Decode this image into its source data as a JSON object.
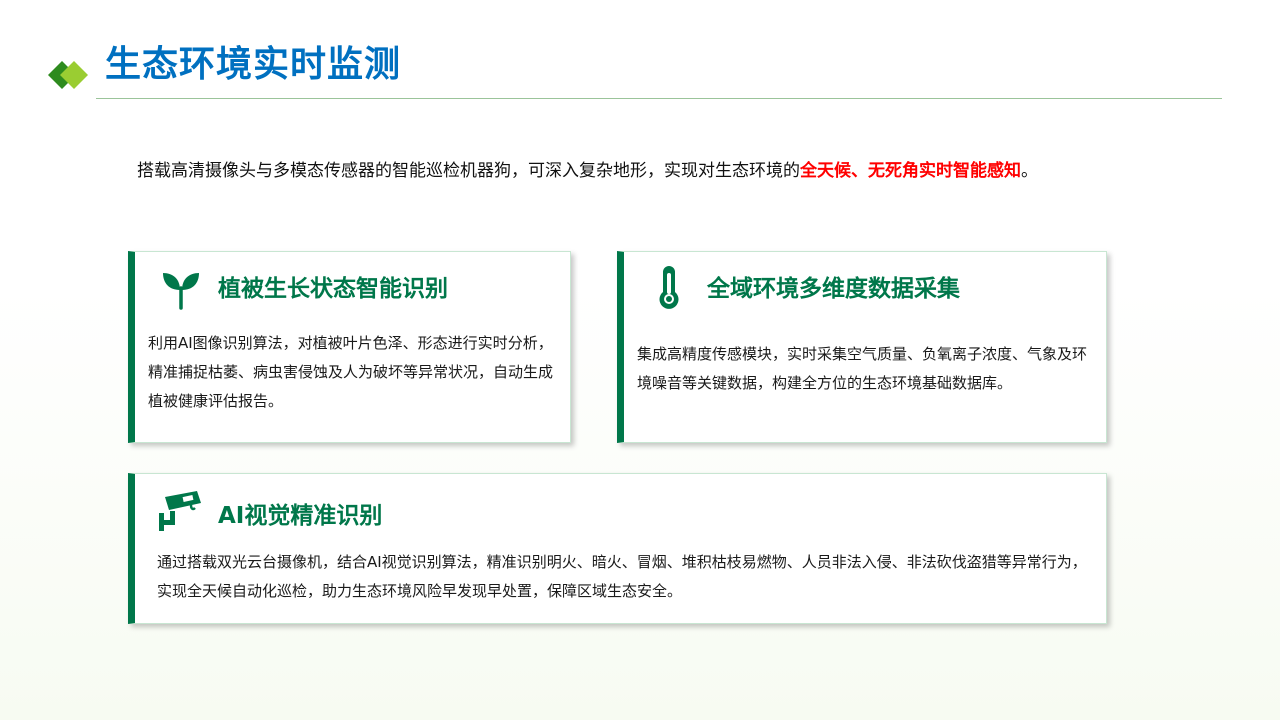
{
  "header": {
    "title": "生态环境实时监测"
  },
  "intro": {
    "text": "搭载高清摄像头与多模态传感器的智能巡检机器狗，可深入复杂地形，实现对生态环境的",
    "highlight": "全天候、无死角实时智能感知",
    "end": "。"
  },
  "cards": [
    {
      "icon": "sprout-icon",
      "title": "植被生长状态智能识别",
      "body": "利用AI图像识别算法，对植被叶片色泽、形态进行实时分析，精准捕捉枯萎、病虫害侵蚀及人为破坏等异常状况，自动生成植被健康评估报告。"
    },
    {
      "icon": "thermometer-icon",
      "title": "全域环境多维度数据采集",
      "body": "集成高精度传感模块，实时采集空气质量、负氧离子浓度、气象及环境噪音等关键数据，构建全方位的生态环境基础数据库。"
    },
    {
      "icon": "security-camera-icon",
      "title": "AI视觉精准识别",
      "body": "通过搭载双光云台摄像机，结合AI视觉识别算法，精准识别明火、暗火、冒烟、堆积枯枝易燃物、人员非法入侵、非法砍伐盗猎等异常行为，实现全天候自动化巡检，助力生态环境风险早发现早处置，保障区域生态安全。"
    }
  ],
  "colors": {
    "title": "#0070c0",
    "accent": "#00774a",
    "highlight": "#ff0000",
    "logo_dark": "#2e8b1e",
    "logo_light": "#9acd32"
  }
}
